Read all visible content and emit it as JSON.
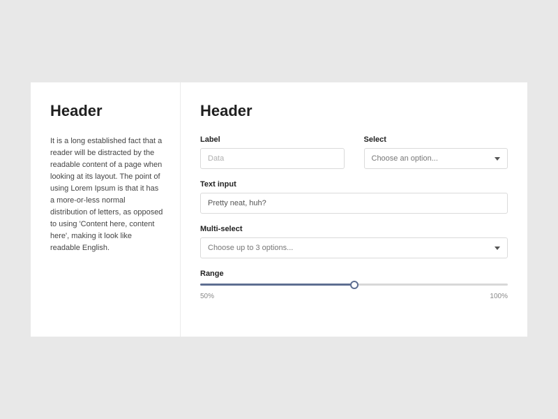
{
  "sidebar": {
    "header": "Header",
    "body": "It is a long established fact that a reader will be distracted by the readable content of a page when looking at its layout. The point of using Lorem Ipsum is that it has a more-or-less normal distribution of letters, as opposed to using 'Content here, content here', making it look like readable English."
  },
  "form": {
    "header": "Header",
    "label_field": {
      "label": "Label",
      "placeholder": "Data"
    },
    "select_field": {
      "label": "Select",
      "placeholder": "Choose an option..."
    },
    "text_input": {
      "label": "Text input",
      "value": "Pretty neat, huh?"
    },
    "multi_select": {
      "label": "Multi-select",
      "placeholder": "Choose up to 3 options..."
    },
    "range": {
      "label": "Range",
      "min_label": "50%",
      "max_label": "100%",
      "value_pct": 50
    }
  }
}
